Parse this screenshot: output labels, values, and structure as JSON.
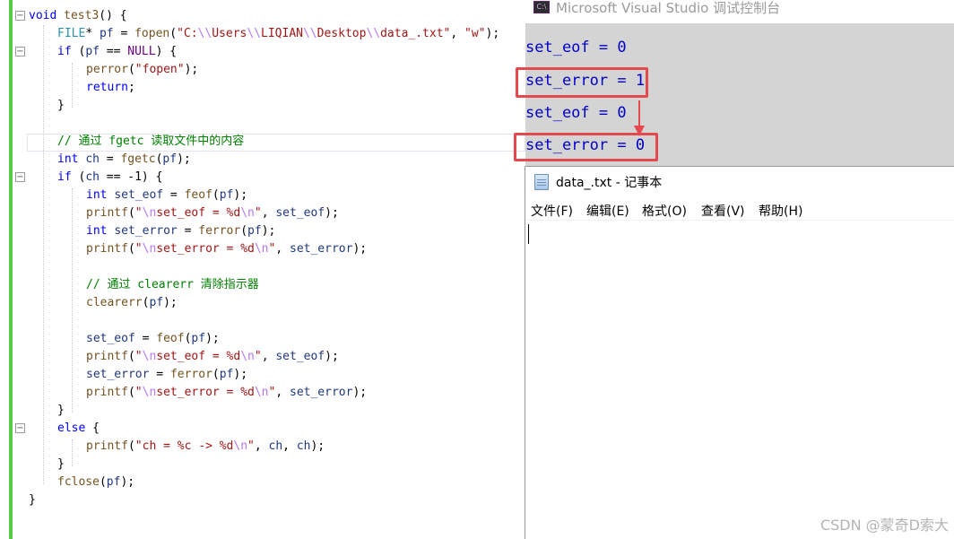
{
  "editor": {
    "lines": [
      [
        [
          "kw",
          "void"
        ],
        [
          "nm",
          " "
        ],
        [
          "fn",
          "test3"
        ],
        [
          "nm",
          "() {"
        ]
      ],
      [
        [
          "ty",
          "FILE"
        ],
        [
          "nm",
          "* "
        ],
        [
          "vr",
          "pf"
        ],
        [
          "nm",
          " = "
        ],
        [
          "fn",
          "fopen"
        ],
        [
          "nm",
          "("
        ],
        [
          "st",
          "\"C:"
        ],
        [
          "esc",
          "\\\\"
        ],
        [
          "st",
          "Users"
        ],
        [
          "esc",
          "\\\\"
        ],
        [
          "st",
          "LIQIAN"
        ],
        [
          "esc",
          "\\\\"
        ],
        [
          "st",
          "Desktop"
        ],
        [
          "esc",
          "\\\\"
        ],
        [
          "st",
          "data_.txt\""
        ],
        [
          "nm",
          ", "
        ],
        [
          "st",
          "\"w\""
        ],
        [
          "nm",
          ");"
        ]
      ],
      [
        [
          "kw",
          "if"
        ],
        [
          "nm",
          " ("
        ],
        [
          "vr",
          "pf"
        ],
        [
          "nm",
          " == "
        ],
        [
          "mc",
          "NULL"
        ],
        [
          "nm",
          ") {"
        ]
      ],
      [
        [
          "fn",
          "perror"
        ],
        [
          "nm",
          "("
        ],
        [
          "st",
          "\"fopen\""
        ],
        [
          "nm",
          ");"
        ]
      ],
      [
        [
          "kw",
          "return"
        ],
        [
          "nm",
          ";"
        ]
      ],
      [
        [
          "nm",
          "}"
        ]
      ],
      [],
      [
        [
          "cm",
          "// 通过 fgetc 读取文件中的内容"
        ]
      ],
      [
        [
          "kw",
          "int"
        ],
        [
          "nm",
          " "
        ],
        [
          "vr",
          "ch"
        ],
        [
          "nm",
          " = "
        ],
        [
          "fn",
          "fgetc"
        ],
        [
          "nm",
          "("
        ],
        [
          "vr",
          "pf"
        ],
        [
          "nm",
          ");"
        ]
      ],
      [
        [
          "kw",
          "if"
        ],
        [
          "nm",
          " ("
        ],
        [
          "vr",
          "ch"
        ],
        [
          "nm",
          " == -1) {"
        ]
      ],
      [
        [
          "kw",
          "int"
        ],
        [
          "nm",
          " "
        ],
        [
          "vr",
          "set_eof"
        ],
        [
          "nm",
          " = "
        ],
        [
          "fn",
          "feof"
        ],
        [
          "nm",
          "("
        ],
        [
          "vr",
          "pf"
        ],
        [
          "nm",
          ");"
        ]
      ],
      [
        [
          "fn",
          "printf"
        ],
        [
          "nm",
          "("
        ],
        [
          "st",
          "\""
        ],
        [
          "esc",
          "\\n"
        ],
        [
          "st",
          "set_eof = %d"
        ],
        [
          "esc",
          "\\n"
        ],
        [
          "st",
          "\""
        ],
        [
          "nm",
          ", "
        ],
        [
          "vr",
          "set_eof"
        ],
        [
          "nm",
          ");"
        ]
      ],
      [
        [
          "kw",
          "int"
        ],
        [
          "nm",
          " "
        ],
        [
          "vr",
          "set_error"
        ],
        [
          "nm",
          " = "
        ],
        [
          "fn",
          "ferror"
        ],
        [
          "nm",
          "("
        ],
        [
          "vr",
          "pf"
        ],
        [
          "nm",
          ");"
        ]
      ],
      [
        [
          "fn",
          "printf"
        ],
        [
          "nm",
          "("
        ],
        [
          "st",
          "\""
        ],
        [
          "esc",
          "\\n"
        ],
        [
          "st",
          "set_error = %d"
        ],
        [
          "esc",
          "\\n"
        ],
        [
          "st",
          "\""
        ],
        [
          "nm",
          ", "
        ],
        [
          "vr",
          "set_error"
        ],
        [
          "nm",
          ");"
        ]
      ],
      [],
      [
        [
          "cm",
          "// 通过 clearerr 清除指示器"
        ]
      ],
      [
        [
          "fn",
          "clearerr"
        ],
        [
          "nm",
          "("
        ],
        [
          "vr",
          "pf"
        ],
        [
          "nm",
          ");"
        ]
      ],
      [],
      [
        [
          "vr",
          "set_eof"
        ],
        [
          "nm",
          " = "
        ],
        [
          "fn",
          "feof"
        ],
        [
          "nm",
          "("
        ],
        [
          "vr",
          "pf"
        ],
        [
          "nm",
          ");"
        ]
      ],
      [
        [
          "fn",
          "printf"
        ],
        [
          "nm",
          "("
        ],
        [
          "st",
          "\""
        ],
        [
          "esc",
          "\\n"
        ],
        [
          "st",
          "set_eof = %d"
        ],
        [
          "esc",
          "\\n"
        ],
        [
          "st",
          "\""
        ],
        [
          "nm",
          ", "
        ],
        [
          "vr",
          "set_eof"
        ],
        [
          "nm",
          ");"
        ]
      ],
      [
        [
          "vr",
          "set_error"
        ],
        [
          "nm",
          " = "
        ],
        [
          "fn",
          "ferror"
        ],
        [
          "nm",
          "("
        ],
        [
          "vr",
          "pf"
        ],
        [
          "nm",
          ");"
        ]
      ],
      [
        [
          "fn",
          "printf"
        ],
        [
          "nm",
          "("
        ],
        [
          "st",
          "\""
        ],
        [
          "esc",
          "\\n"
        ],
        [
          "st",
          "set_error = %d"
        ],
        [
          "esc",
          "\\n"
        ],
        [
          "st",
          "\""
        ],
        [
          "nm",
          ", "
        ],
        [
          "vr",
          "set_error"
        ],
        [
          "nm",
          ");"
        ]
      ],
      [
        [
          "nm",
          "}"
        ]
      ],
      [
        [
          "kw",
          "else"
        ],
        [
          "nm",
          " {"
        ]
      ],
      [
        [
          "fn",
          "printf"
        ],
        [
          "nm",
          "("
        ],
        [
          "st",
          "\"ch = %c -> %d"
        ],
        [
          "esc",
          "\\n"
        ],
        [
          "st",
          "\""
        ],
        [
          "nm",
          ", "
        ],
        [
          "vr",
          "ch"
        ],
        [
          "nm",
          ", "
        ],
        [
          "vr",
          "ch"
        ],
        [
          "nm",
          ");"
        ]
      ],
      [
        [
          "nm",
          "}"
        ]
      ],
      [
        [
          "fn",
          "fclose"
        ],
        [
          "nm",
          "("
        ],
        [
          "vr",
          "pf"
        ],
        [
          "nm",
          ");"
        ]
      ],
      [
        [
          "nm",
          "}"
        ]
      ]
    ],
    "fold_minus": "−",
    "colors": {
      "added_bar": "#57c84a",
      "keyword": "#0000ff",
      "string": "#a31515",
      "comment": "#008000"
    }
  },
  "console": {
    "title": "Microsoft Visual Studio 调试控制台",
    "icon": "C:\\",
    "lines": [
      "set_eof = 0",
      "set_error = 1",
      "set_eof = 0",
      "set_error = 0"
    ],
    "colors": {
      "text": "#0000c8",
      "background": "#d4d4d4",
      "highlight": "#e5484d"
    }
  },
  "notepad": {
    "title": "data_.txt - 记事本",
    "menu": [
      "文件(F)",
      "编辑(E)",
      "格式(O)",
      "查看(V)",
      "帮助(H)"
    ],
    "content": ""
  },
  "watermark": "CSDN @蒙奇D索大"
}
